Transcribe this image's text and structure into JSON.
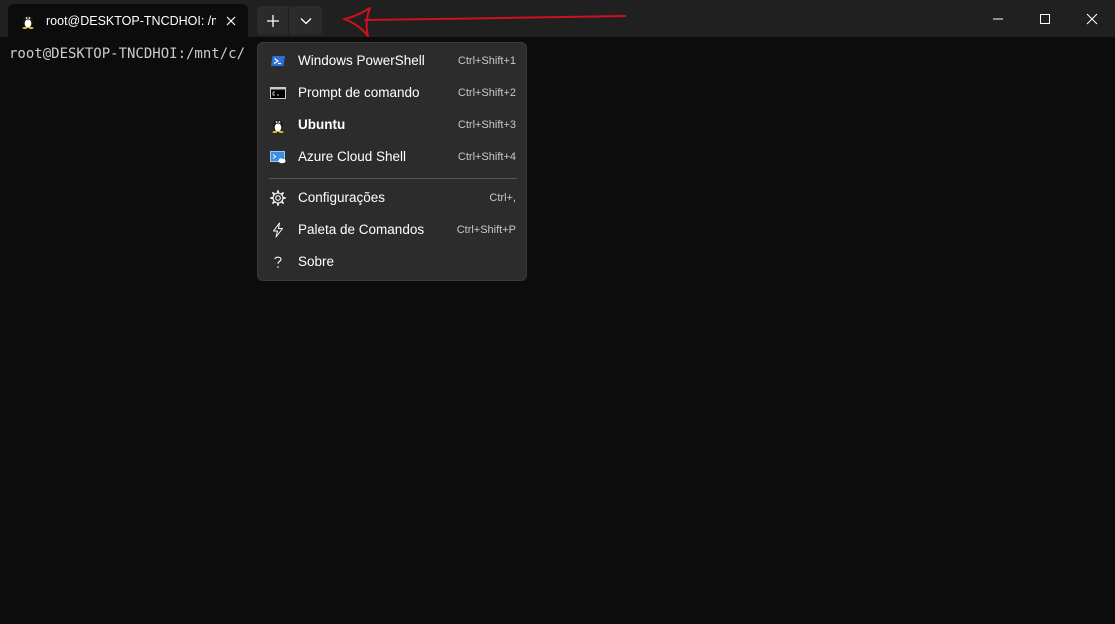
{
  "tab": {
    "title": "root@DESKTOP-TNCDHOI: /mn",
    "icon": "tux-icon"
  },
  "toolbar": {
    "new_tab_icon": "plus-icon",
    "dropdown_icon": "chevron-down-icon"
  },
  "window_controls": {
    "minimize_icon": "minimize-icon",
    "maximize_icon": "maximize-icon",
    "close_icon": "close-icon"
  },
  "terminal": {
    "prompt": "root@DESKTOP-TNCDHOI:/mnt/c/"
  },
  "menu": {
    "profiles": [
      {
        "label": "Windows PowerShell",
        "shortcut": "Ctrl+Shift+1",
        "icon": "powershell-icon"
      },
      {
        "label": "Prompt de comando",
        "shortcut": "Ctrl+Shift+2",
        "icon": "cmd-icon"
      },
      {
        "label": "Ubuntu",
        "shortcut": "Ctrl+Shift+3",
        "icon": "tux-icon"
      },
      {
        "label": "Azure Cloud Shell",
        "shortcut": "Ctrl+Shift+4",
        "icon": "azure-icon"
      }
    ],
    "actions": [
      {
        "label": "Configurações",
        "shortcut": "Ctrl+,",
        "icon": "gear-icon"
      },
      {
        "label": "Paleta de Comandos",
        "shortcut": "Ctrl+Shift+P",
        "icon": "lightning-icon"
      },
      {
        "label": "Sobre",
        "shortcut": "",
        "icon": "question-icon"
      }
    ]
  },
  "colors": {
    "background": "#0c0c0c",
    "titlebar": "#202020",
    "menu_background": "#2c2c2c",
    "annotation": "#d01020"
  }
}
